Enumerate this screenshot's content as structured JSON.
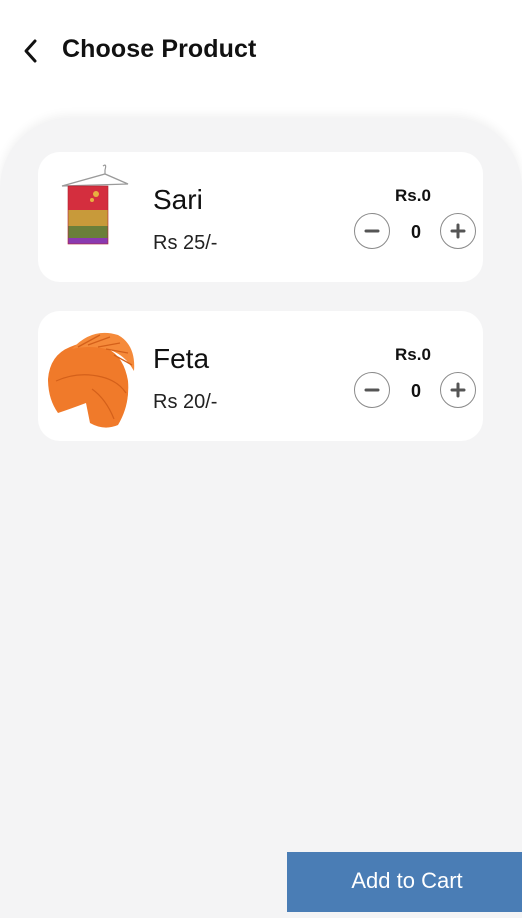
{
  "header": {
    "title": "Choose Product",
    "back_icon": "chevron-left-icon"
  },
  "products": [
    {
      "name": "Sari",
      "price": "Rs 25/-",
      "total": "Rs.0",
      "quantity": "0",
      "image_icon": "sari-image"
    },
    {
      "name": "Feta",
      "price": "Rs 20/-",
      "total": "Rs.0",
      "quantity": "0",
      "image_icon": "feta-image"
    }
  ],
  "footer": {
    "add_to_cart_label": "Add to Cart"
  },
  "colors": {
    "primary_button": "#4a7db5",
    "background": "#f4f4f5",
    "card": "#ffffff"
  }
}
